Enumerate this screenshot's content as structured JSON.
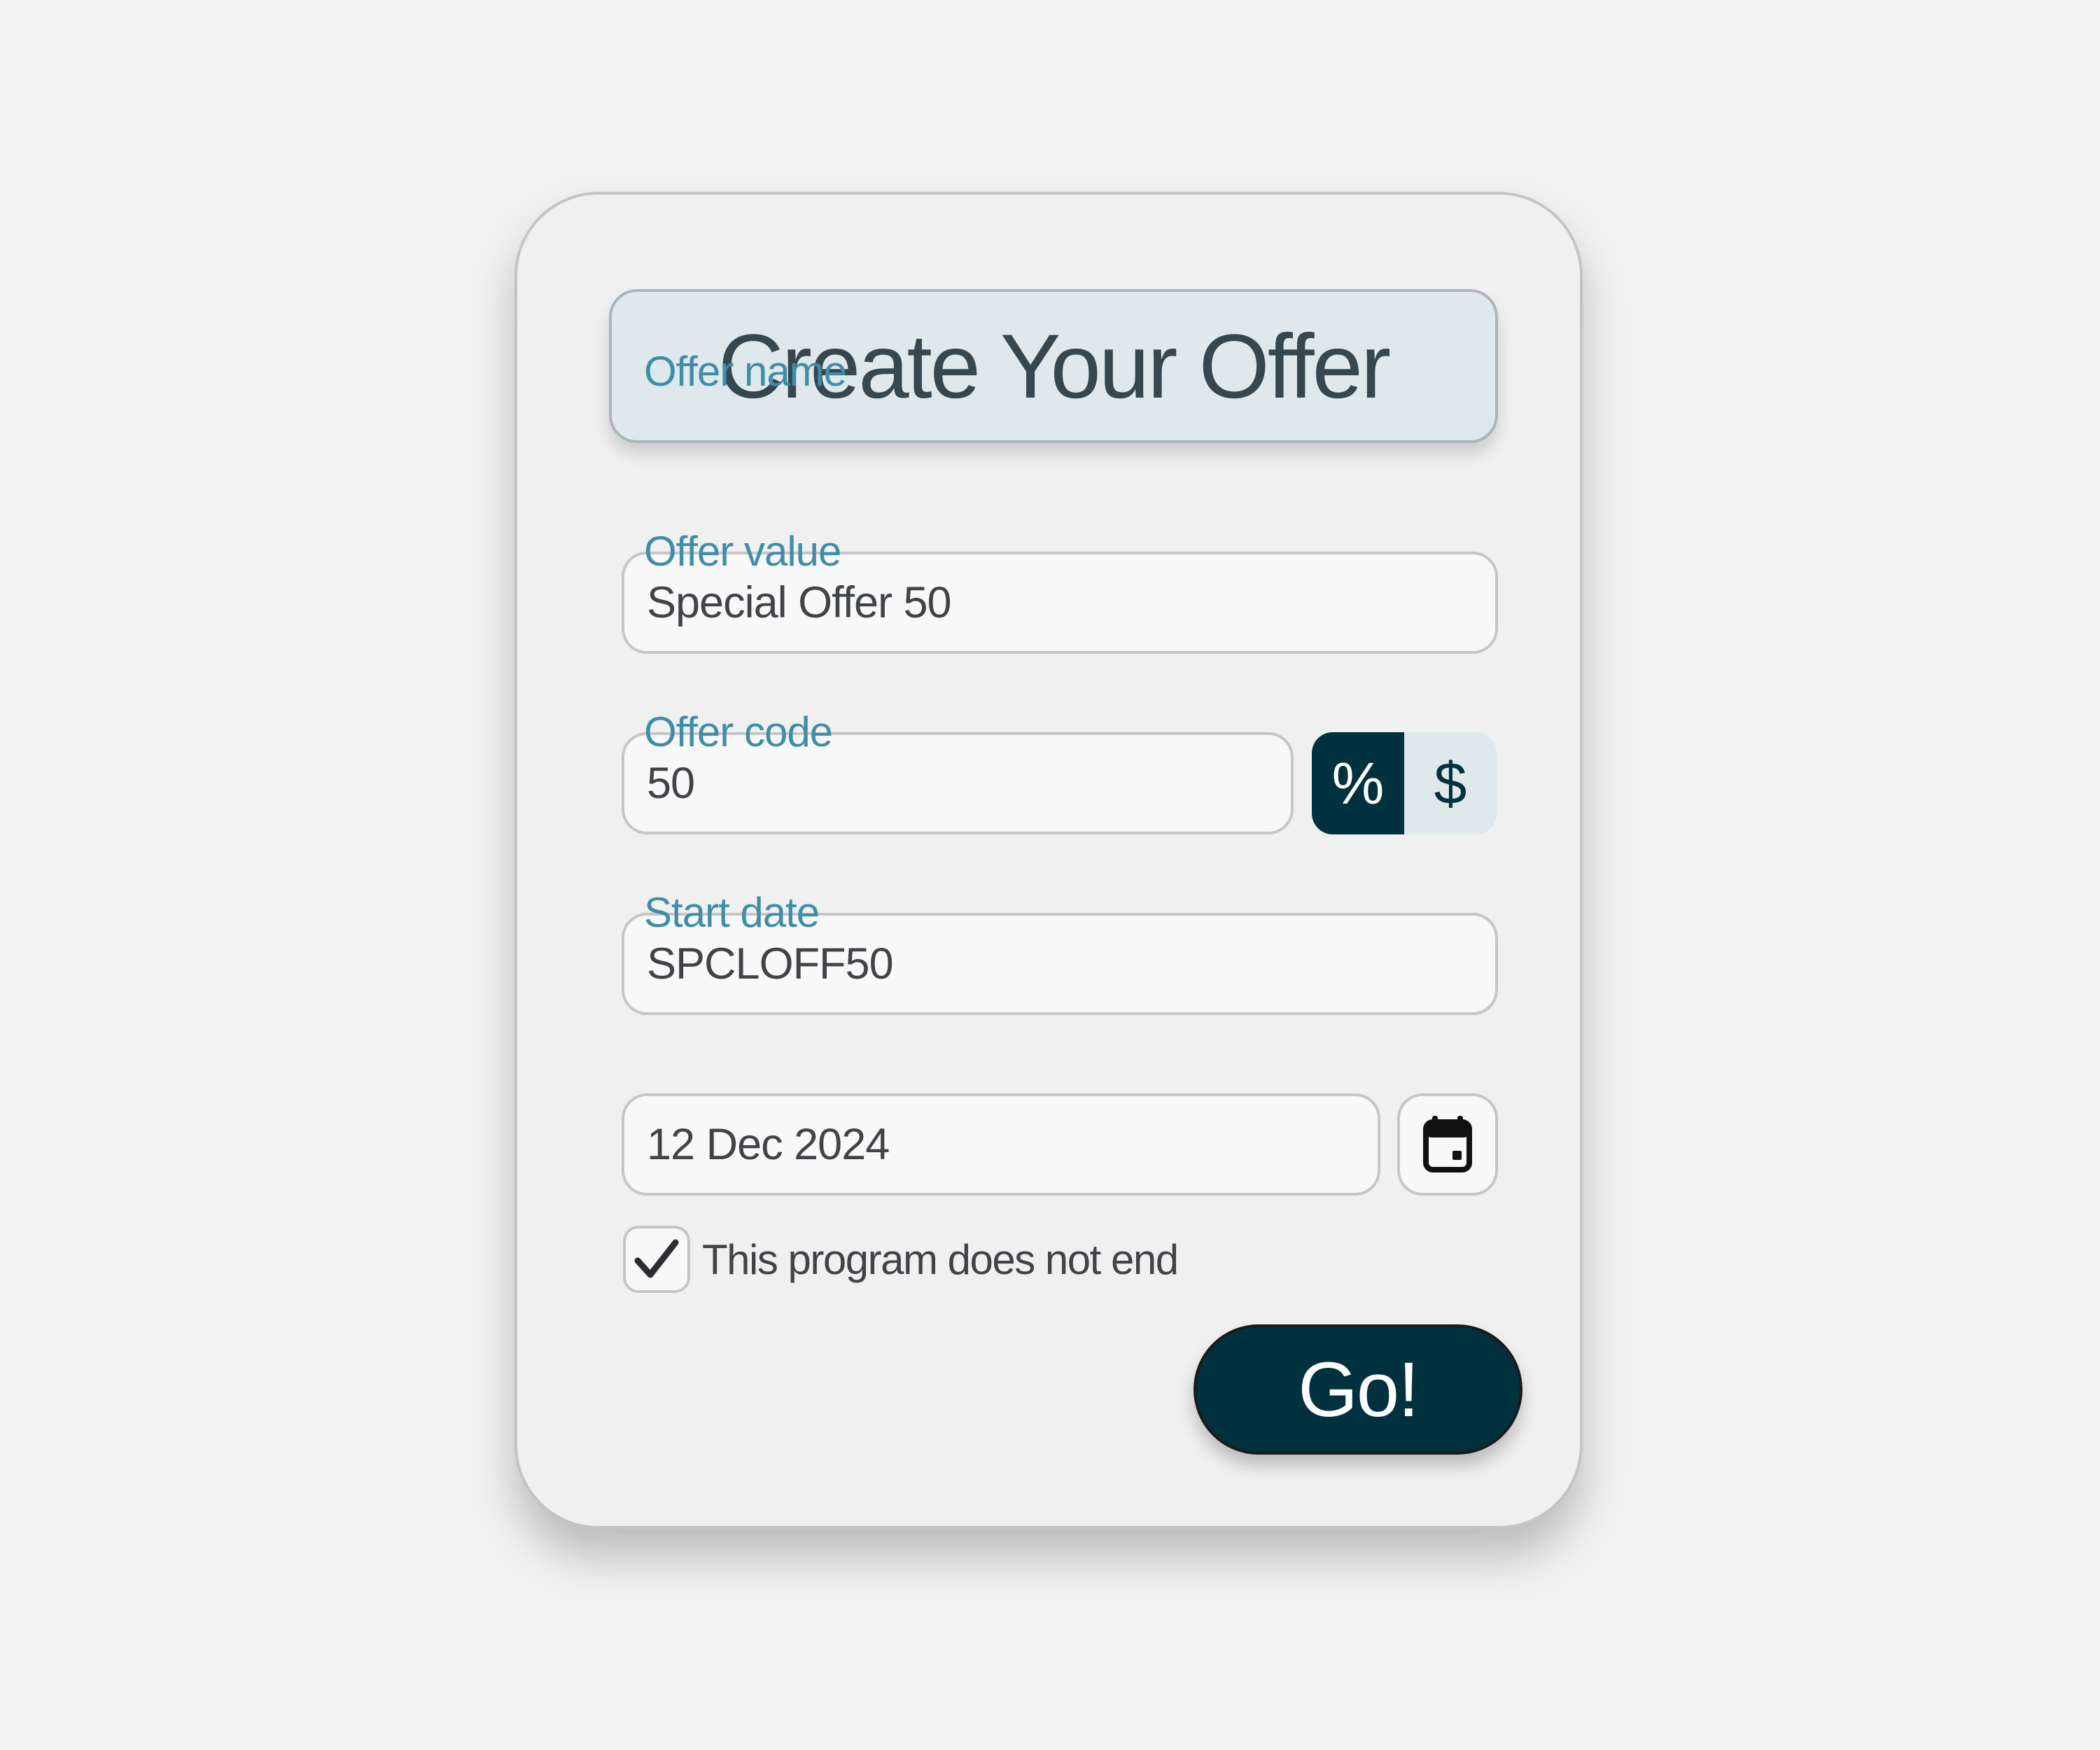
{
  "form": {
    "title": "Create Your Offer",
    "offer_name": {
      "label": "Offer name",
      "value": "Special Offer 50"
    },
    "offer_value": {
      "label": "Offer value",
      "value": "50",
      "units": [
        {
          "label": "%",
          "selected": true
        },
        {
          "label": "$",
          "selected": false
        }
      ]
    },
    "offer_code": {
      "label": "Offer code",
      "value": "SPCLOFF50"
    },
    "start_date": {
      "label": "Start date",
      "value": "12 Dec 2024",
      "picker_icon": "calendar-icon"
    },
    "no_end": {
      "label": "This program does not end",
      "checked": true,
      "check_icon": "checkmark-icon"
    },
    "submit_label": "Go!"
  },
  "colors": {
    "background": "#f1f1f1",
    "card": "#f0f0f0",
    "title_bg": "#dfe8eb",
    "title_text": "#36474f",
    "label": "#3e8ea8",
    "primary": "#00313f",
    "field_border": "#c6c6c6",
    "field_text": "#404448"
  }
}
